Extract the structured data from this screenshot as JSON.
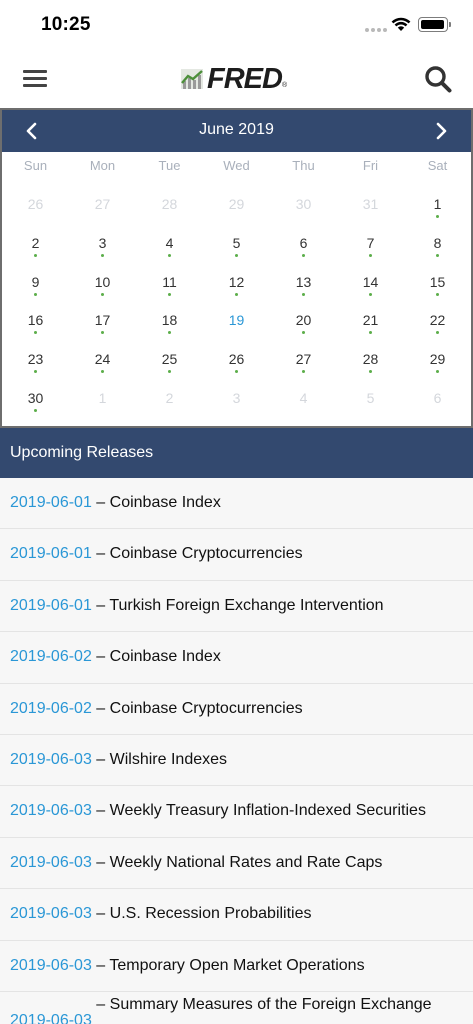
{
  "status": {
    "time": "10:25"
  },
  "header": {
    "logo_text": "FRED"
  },
  "calendar": {
    "month_label": "June 2019",
    "weekdays": [
      "Sun",
      "Mon",
      "Tue",
      "Wed",
      "Thu",
      "Fri",
      "Sat"
    ],
    "weeks": [
      [
        {
          "d": "26",
          "m": true
        },
        {
          "d": "27",
          "m": true
        },
        {
          "d": "28",
          "m": true
        },
        {
          "d": "29",
          "m": true
        },
        {
          "d": "30",
          "m": true
        },
        {
          "d": "31",
          "m": true
        },
        {
          "d": "1",
          "dot": true
        }
      ],
      [
        {
          "d": "2",
          "dot": true
        },
        {
          "d": "3",
          "dot": true
        },
        {
          "d": "4",
          "dot": true
        },
        {
          "d": "5",
          "dot": true
        },
        {
          "d": "6",
          "dot": true
        },
        {
          "d": "7",
          "dot": true
        },
        {
          "d": "8",
          "dot": true
        }
      ],
      [
        {
          "d": "9",
          "dot": true
        },
        {
          "d": "10",
          "dot": true
        },
        {
          "d": "11",
          "dot": true
        },
        {
          "d": "12",
          "dot": true
        },
        {
          "d": "13",
          "dot": true
        },
        {
          "d": "14",
          "dot": true
        },
        {
          "d": "15",
          "dot": true
        }
      ],
      [
        {
          "d": "16",
          "dot": true
        },
        {
          "d": "17",
          "dot": true
        },
        {
          "d": "18",
          "dot": true
        },
        {
          "d": "19",
          "today": true
        },
        {
          "d": "20",
          "dot": true
        },
        {
          "d": "21",
          "dot": true
        },
        {
          "d": "22",
          "dot": true
        }
      ],
      [
        {
          "d": "23",
          "dot": true
        },
        {
          "d": "24",
          "dot": true
        },
        {
          "d": "25",
          "dot": true
        },
        {
          "d": "26",
          "dot": true
        },
        {
          "d": "27",
          "dot": true
        },
        {
          "d": "28",
          "dot": true
        },
        {
          "d": "29",
          "dot": true
        }
      ],
      [
        {
          "d": "30",
          "dot": true
        },
        {
          "d": "1",
          "m": true
        },
        {
          "d": "2",
          "m": true
        },
        {
          "d": "3",
          "m": true
        },
        {
          "d": "4",
          "m": true
        },
        {
          "d": "5",
          "m": true
        },
        {
          "d": "6",
          "m": true
        }
      ]
    ]
  },
  "upcoming": {
    "title": "Upcoming Releases",
    "items": [
      {
        "date": "2019-06-01",
        "name": "Coinbase Index"
      },
      {
        "date": "2019-06-01",
        "name": "Coinbase Cryptocurrencies"
      },
      {
        "date": "2019-06-01",
        "name": "Turkish Foreign Exchange Intervention"
      },
      {
        "date": "2019-06-02",
        "name": "Coinbase Index"
      },
      {
        "date": "2019-06-02",
        "name": "Coinbase Cryptocurrencies"
      },
      {
        "date": "2019-06-03",
        "name": "Wilshire Indexes"
      },
      {
        "date": "2019-06-03",
        "name": "Weekly Treasury Inflation-Indexed Securities"
      },
      {
        "date": "2019-06-03",
        "name": "Weekly National Rates and Rate Caps"
      },
      {
        "date": "2019-06-03",
        "name": "U.S. Recession Probabilities"
      },
      {
        "date": "2019-06-03",
        "name": "Temporary Open Market Operations"
      },
      {
        "date": "2019-06-03",
        "name": "Summary Measures of the Foreign Exchange",
        "wrap": true
      }
    ]
  },
  "colors": {
    "navy": "#33496f",
    "link_blue": "#2a97d6",
    "event_dot": "#5cae4a"
  }
}
